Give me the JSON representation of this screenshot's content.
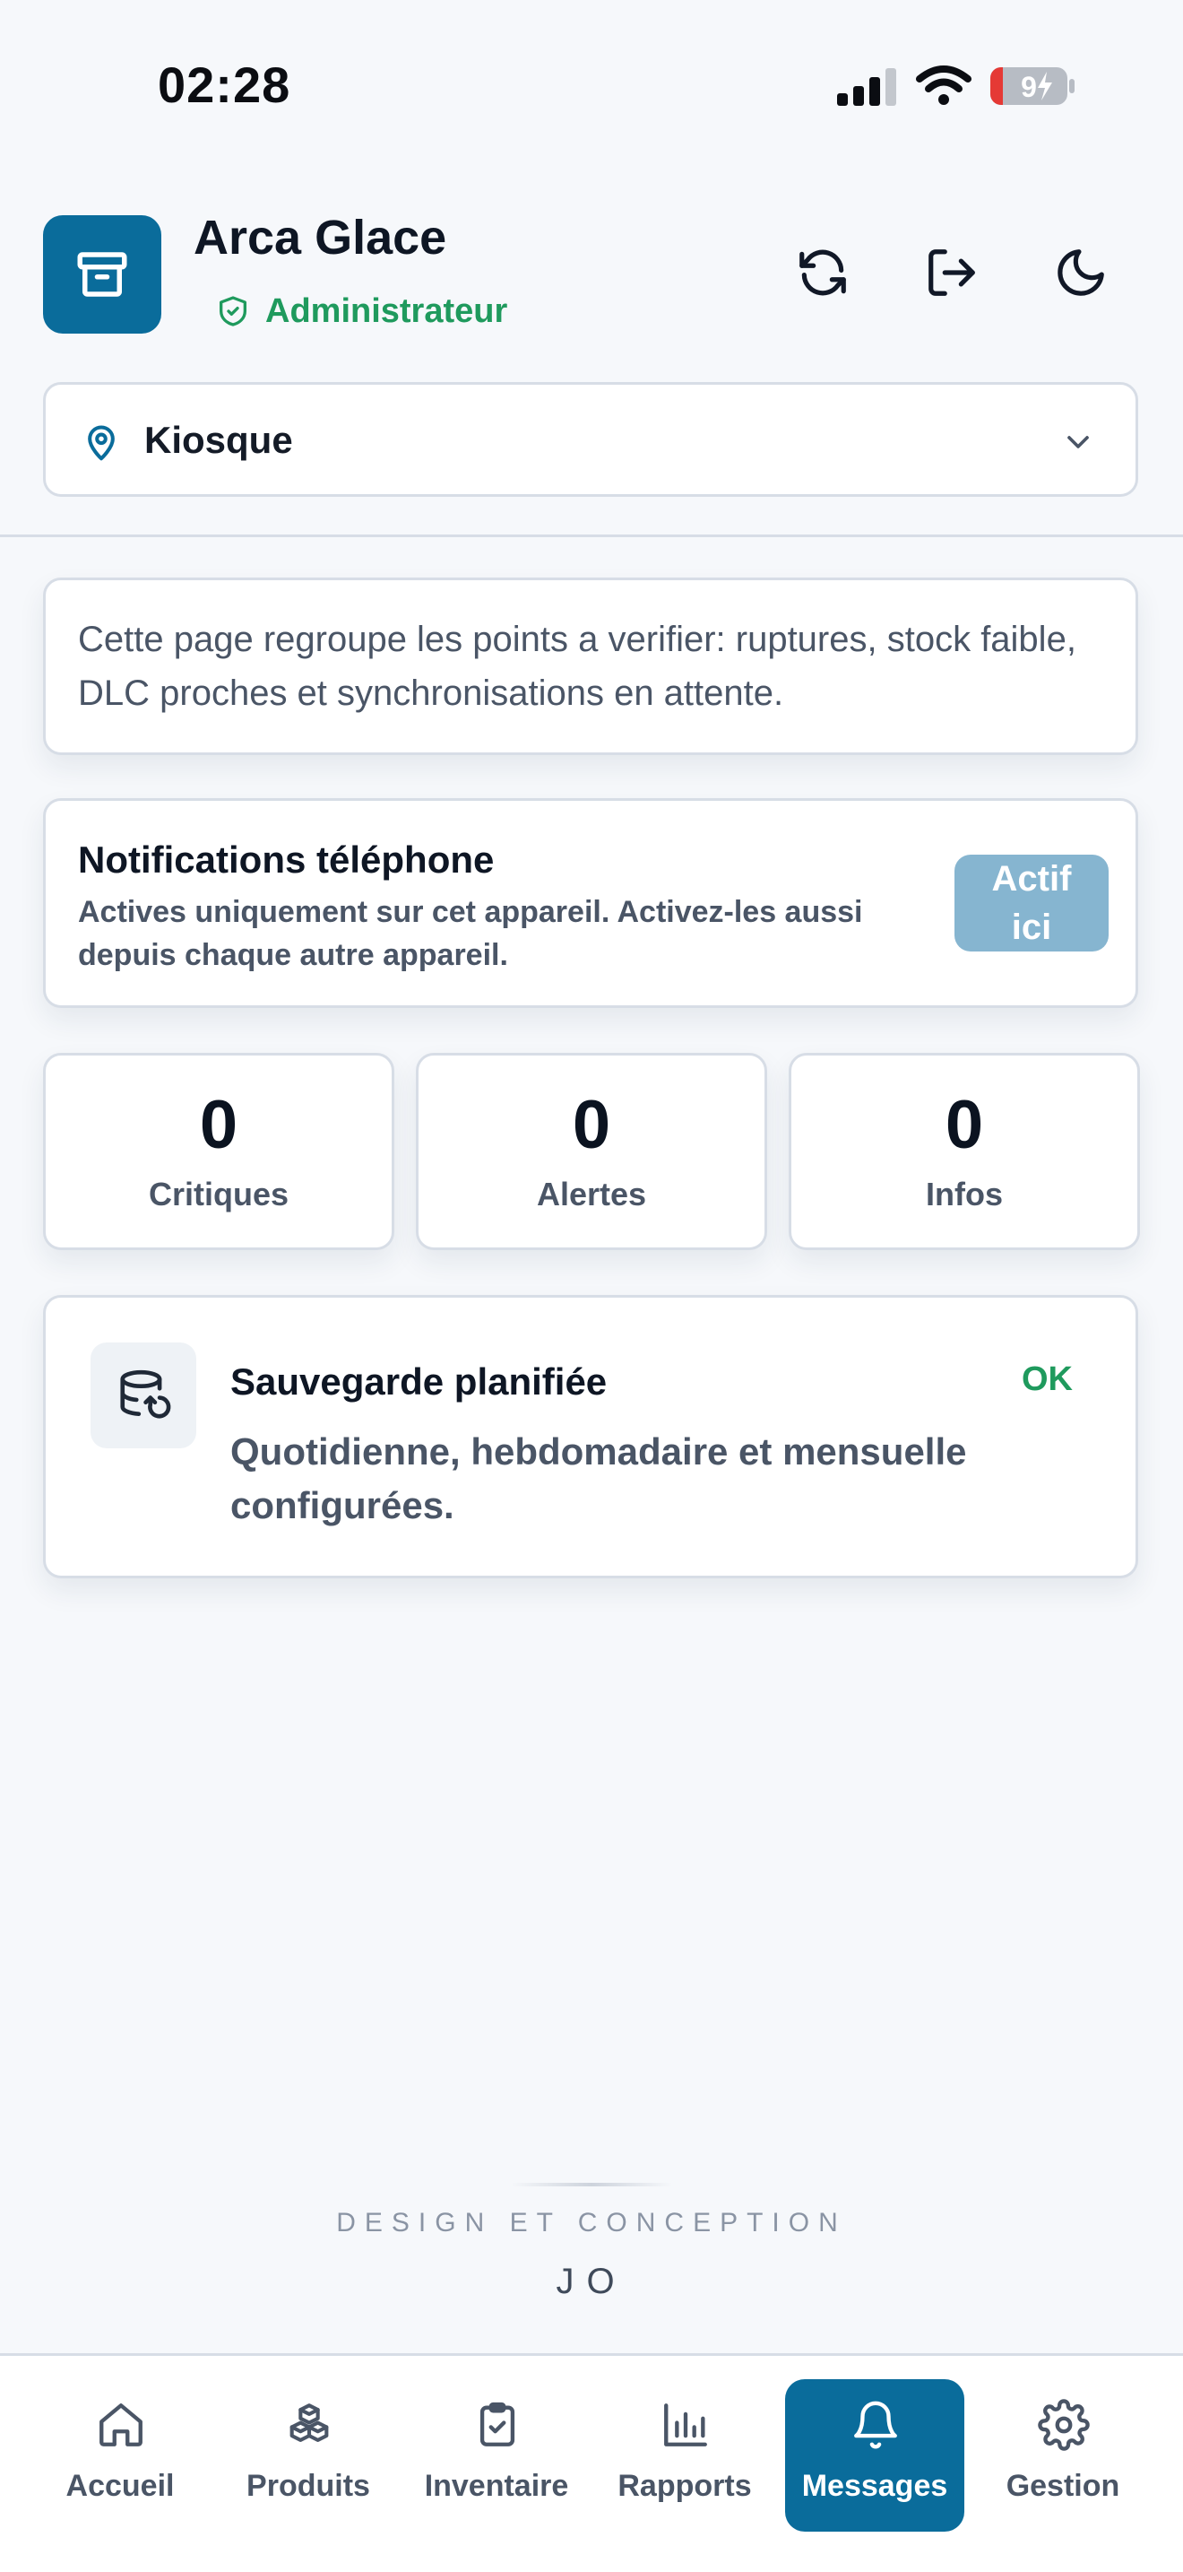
{
  "status_bar": {
    "time": "02:28",
    "battery_level": "9",
    "icons": [
      "cellular-signal-icon",
      "wifi-icon",
      "battery-charging-icon"
    ]
  },
  "header": {
    "app_name": "Arca Glace",
    "role": "Administrateur",
    "actions": [
      "refresh-icon",
      "logout-icon",
      "dark-mode-icon"
    ],
    "location": {
      "selected": "Kiosque"
    }
  },
  "info": {
    "text": "Cette page regroupe les points a verifier: ruptures, stock faible, DLC proches et synchronisations en attente."
  },
  "notifications": {
    "title": "Notifications téléphone",
    "description": "Actives uniquement sur cet appareil. Activez-les aussi depuis chaque autre appareil.",
    "button_label": "Actif ici"
  },
  "stats": [
    {
      "value": "0",
      "label": "Critiques"
    },
    {
      "value": "0",
      "label": "Alertes"
    },
    {
      "value": "0",
      "label": "Infos"
    }
  ],
  "backup": {
    "title": "Sauvegarde planifiée",
    "status": "OK",
    "description": "Quotidienne, hebdomadaire et mensuelle configurées."
  },
  "credit": {
    "caption": "DESIGN ET CONCEPTION",
    "name": "JO"
  },
  "nav": {
    "active": "Messages",
    "items": [
      {
        "label": "Accueil",
        "icon": "home-icon"
      },
      {
        "label": "Produits",
        "icon": "boxes-icon"
      },
      {
        "label": "Inventaire",
        "icon": "clipboard-check-icon"
      },
      {
        "label": "Rapports",
        "icon": "bar-chart-icon"
      },
      {
        "label": "Messages",
        "icon": "bell-icon"
      },
      {
        "label": "Gestion",
        "icon": "gear-icon"
      }
    ]
  },
  "colors": {
    "primary": "#0a6c9b",
    "success": "#1f9a5d",
    "background": "#f6f8fb",
    "muted_text": "#4a5566",
    "button_disabled": "#86b5d0"
  }
}
